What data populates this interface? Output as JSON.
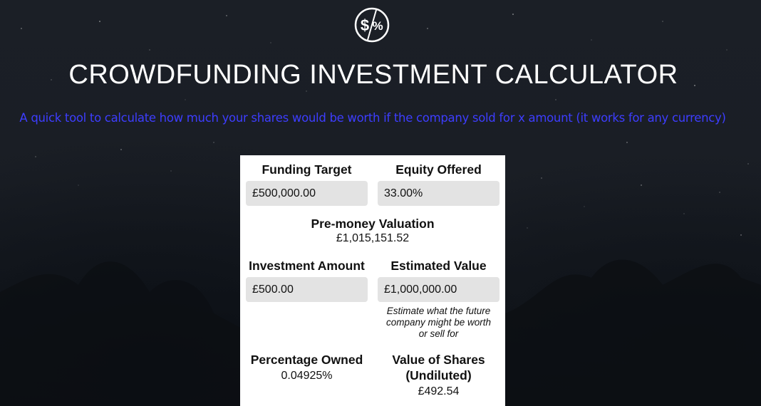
{
  "header": {
    "logo_icon": "dollar-percent-icon",
    "title": "CROWDFUNDING INVESTMENT CALCULATOR",
    "subtitle": "A quick tool to calculate how much your shares would be worth if the company sold for x amount (it works for any currency)"
  },
  "colors": {
    "subtitle": "#3d3dff",
    "card_background": "#ffffff",
    "field_background": "#e3e3e3"
  },
  "calculator": {
    "funding_target": {
      "label": "Funding Target",
      "value": "£500,000.00"
    },
    "equity_offered": {
      "label": "Equity Offered",
      "value": "33.00%"
    },
    "pre_money_valuation": {
      "label": "Pre-money Valuation",
      "value": "£1,015,151.52"
    },
    "investment_amount": {
      "label": "Investment Amount",
      "value": "£500.00"
    },
    "estimated_value": {
      "label": "Estimated Value",
      "value": "£1,000,000.00",
      "note": "Estimate what the future company might be worth or sell for"
    },
    "percentage_owned": {
      "label": "Percentage Owned",
      "value": "0.04925%"
    },
    "value_of_shares": {
      "label": "Value of Shares (Undiluted)",
      "value": "£492.54"
    }
  }
}
